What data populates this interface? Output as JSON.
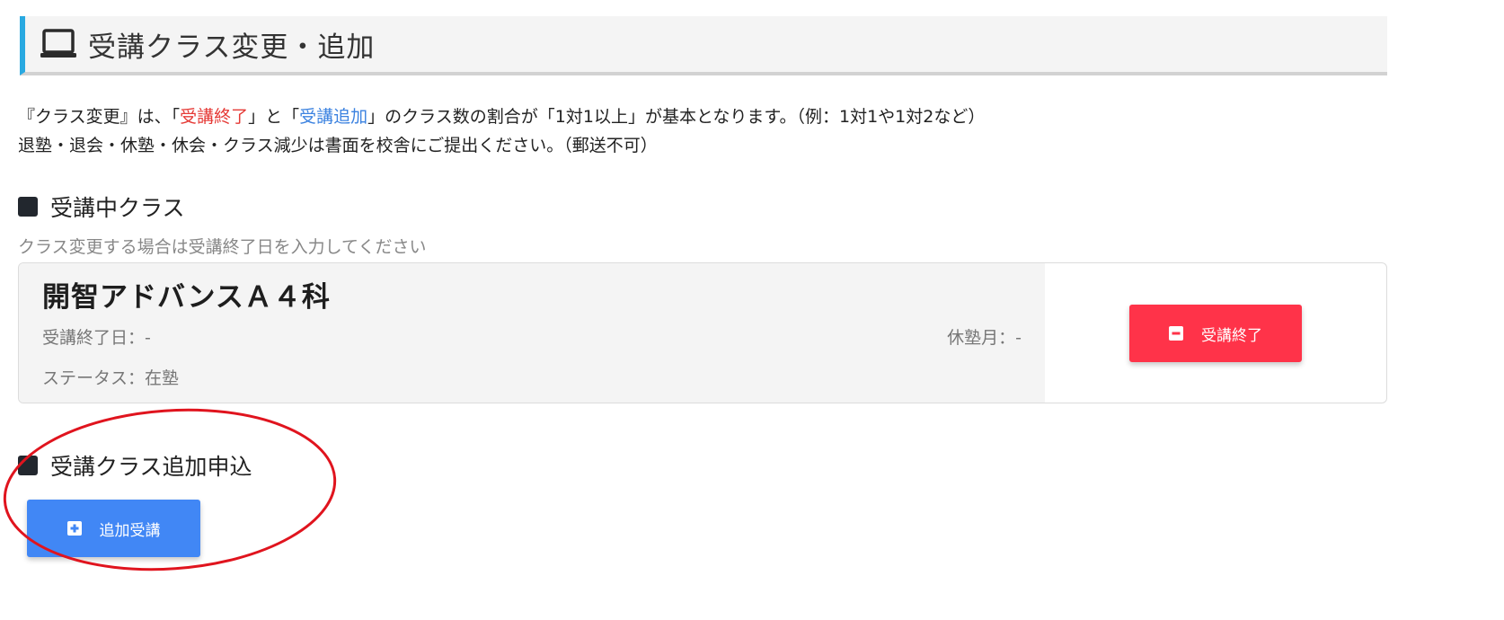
{
  "header": {
    "title": "受講クラス変更・追加",
    "icon": "monitor-icon",
    "accent_color": "#29a9e1"
  },
  "notice": {
    "line1_prefix": "『クラス変更』は、「",
    "line1_end": "受講終了",
    "line1_mid": "」と「",
    "line1_add": "受講追加",
    "line1_suffix": "」のクラス数の割合が「1対1以上」が基本となります。（例：1対1や1対2など）",
    "line2": "退塾・退会・休塾・休会・クラス減少は書面を校舎にご提出ください。（郵送不可）"
  },
  "current_section": {
    "heading": "受講中クラス",
    "hint": "クラス変更する場合は受講終了日を入力してください",
    "card": {
      "class_name": "開智アドバンスＡ４科",
      "end_date_label": "受講終了日：-",
      "status_label": "ステータス：在塾",
      "leave_month_label": "休塾月：-",
      "end_button_label": "受講終了",
      "end_button_color": "#ff3349"
    }
  },
  "add_section": {
    "heading": "受講クラス追加申込",
    "add_button_label": "追加受講",
    "add_button_color": "#4187f5"
  },
  "annotation": {
    "shape": "ellipse",
    "color": "#e0141e"
  }
}
